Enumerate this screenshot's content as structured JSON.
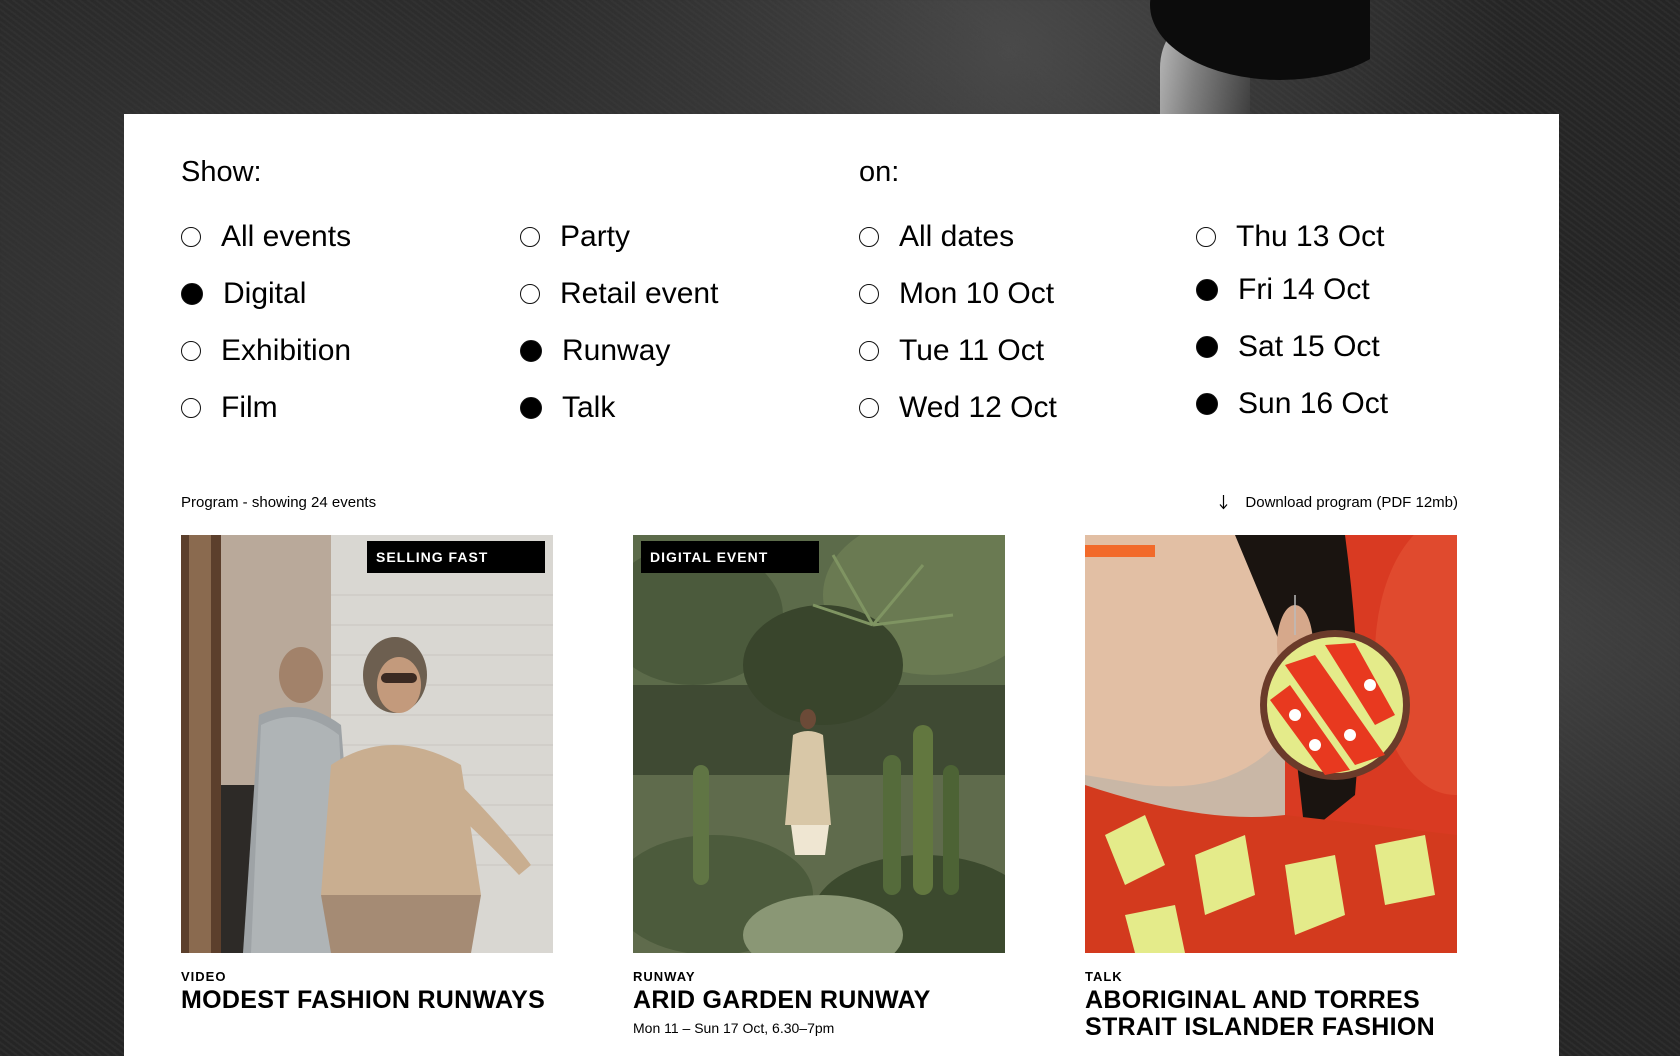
{
  "filters": {
    "show_heading": "Show:",
    "on_heading": "on:",
    "event_types_col1": [
      {
        "label": "All events",
        "selected": false
      },
      {
        "label": "Digital",
        "selected": true
      },
      {
        "label": "Exhibition",
        "selected": false
      },
      {
        "label": "Film",
        "selected": false
      }
    ],
    "event_types_col2": [
      {
        "label": "Party",
        "selected": false
      },
      {
        "label": "Retail event",
        "selected": false
      },
      {
        "label": "Runway",
        "selected": true
      },
      {
        "label": "Talk",
        "selected": true
      }
    ],
    "dates_col1": [
      {
        "label": "All dates",
        "selected": false
      },
      {
        "label": "Mon 10 Oct",
        "selected": false
      },
      {
        "label": "Tue 11 Oct",
        "selected": false
      },
      {
        "label": "Wed 12 Oct",
        "selected": false
      }
    ],
    "dates_col2": [
      {
        "label": "Thu 13 Oct",
        "selected": false
      },
      {
        "label": "Fri 14 Oct",
        "selected": true
      },
      {
        "label": "Sat 15 Oct",
        "selected": true
      },
      {
        "label": "Sun 16 Oct",
        "selected": true
      }
    ]
  },
  "program": {
    "count_text": "Program - showing 24 events",
    "download_label": "Download program (PDF 12mb)",
    "download_icon": "arrow-down-icon"
  },
  "cards": [
    {
      "badge": "SELLING FAST",
      "type": "VIDEO",
      "title": "MODEST FASHION RUNWAYS",
      "date": ""
    },
    {
      "badge": "DIGITAL EVENT",
      "type": "RUNWAY",
      "title": "ARID GARDEN RUNWAY",
      "date": "Mon 11 – Sun 17 Oct, 6.30–7pm"
    },
    {
      "badge": "",
      "type": "TALK",
      "title": "ABORIGINAL AND TORRES STRAIT ISLANDER FASHION",
      "date": ""
    }
  ],
  "colors": {
    "background": "#262626",
    "panel": "#ffffff",
    "text": "#000000",
    "badge_bg": "#000000",
    "badge_text": "#ffffff",
    "accent_red": "#e8391f",
    "accent_yellow": "#e4eb8a"
  }
}
